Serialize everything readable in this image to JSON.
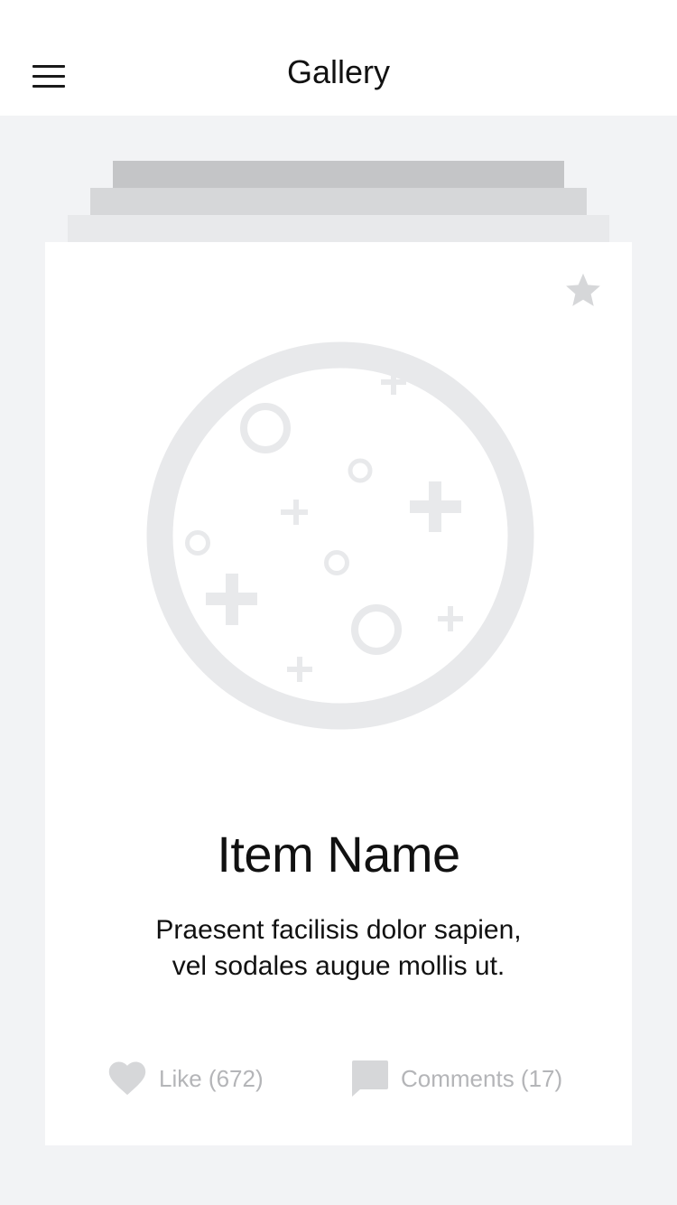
{
  "header": {
    "title": "Gallery",
    "menu_icon": "hamburger-menu-icon"
  },
  "card": {
    "favorite_icon": "star-icon",
    "image_icon": "image-placeholder-icon",
    "item_name": "Item Name",
    "description_line1": "Praesent facilisis dolor sapien,",
    "description_line2": "vel sodales augue mollis ut.",
    "like_label": "Like (672)",
    "like_icon": "heart-icon",
    "comments_label": "Comments (17)",
    "comments_icon": "comment-icon"
  },
  "colors": {
    "background": "#f2f3f5",
    "card": "#ffffff",
    "placeholder_gray": "#e8e9eb",
    "icon_gray": "#d6d7d9",
    "action_text": "#b4b5b8",
    "text": "#111111"
  }
}
